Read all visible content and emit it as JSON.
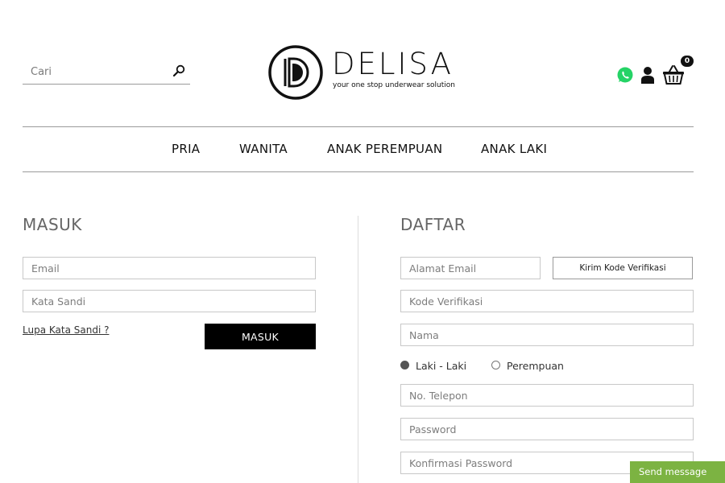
{
  "header": {
    "search_placeholder": "Cari",
    "logo_word": "DELISA",
    "logo_tagline": "your one stop underwear solution",
    "cart_count": "0"
  },
  "nav": {
    "items": [
      {
        "label": "PRIA"
      },
      {
        "label": "WANITA"
      },
      {
        "label": "ANAK PEREMPUAN"
      },
      {
        "label": "ANAK LAKI"
      }
    ]
  },
  "login": {
    "title": "MASUK",
    "email_placeholder": "Email",
    "password_placeholder": "Kata Sandi",
    "forgot_label": "Lupa Kata Sandi ?",
    "submit_label": "MASUK"
  },
  "register": {
    "title": "DAFTAR",
    "email_placeholder": "Alamat Email",
    "send_code_label": "Kirim Kode Verifikasi",
    "code_placeholder": "Kode Verifikasi",
    "name_placeholder": "Nama",
    "gender_options": [
      {
        "label": "Laki - Laki",
        "selected": true
      },
      {
        "label": "Perempuan",
        "selected": false
      }
    ],
    "phone_placeholder": "No. Telepon",
    "password_placeholder": "Password",
    "confirm_placeholder": "Konfirmasi Password"
  },
  "chat": {
    "label": "Send message"
  },
  "colors": {
    "accent_dark": "#000000",
    "whatsapp": "#25D366",
    "chat_green": "#7cb342"
  }
}
